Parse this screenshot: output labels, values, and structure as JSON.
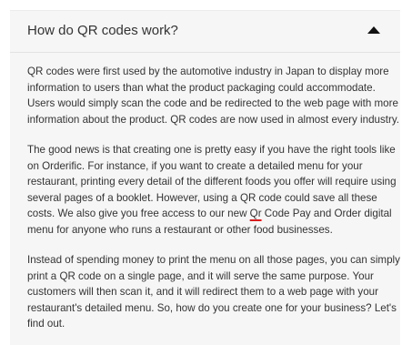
{
  "faq": {
    "question": "How do QR codes work?",
    "toggle_icon": "caret-up-icon",
    "paragraphs": [
      {
        "lines": [
          "QR codes were first used by the automotive industry in Japan to display more",
          "information to users than what the product packaging could accommodate.",
          "Users would simply scan the code and be redirected to the web page with more",
          "information about the product. QR codes are now used in almost every industry."
        ]
      },
      {
        "lines": [
          "The good news is that creating one is pretty easy if you have the right tools like",
          "on Orderific. For instance, if you want to create a detailed menu for your",
          "restaurant, printing every detail of the different foods you offer will require using",
          "several pages of a booklet. However, using a QR code could save all these"
        ],
        "line5": {
          "before": "costs. We also give you free access to our new ",
          "marked_word": "Qr",
          "after": " Code Pay and Order digital"
        },
        "line6": {
          "before": "menu for anyone who runs a restaurant or other ",
          "marked_word": "food",
          "after": " businesses."
        }
      },
      {
        "lines": [
          "Instead of spending money to print the menu on all those pages, you can simply",
          "print a QR code on a single page, and it will serve the same purpose. Your",
          "customers will then scan it, and it will redirect them to a web page with your",
          "restaurant's detailed menu. So, how do you create one for your business? Let's",
          "find out."
        ]
      }
    ]
  },
  "colors": {
    "panel_background": "#f6f6f6",
    "text": "#333333",
    "spellcheck_underline": "#d81c1c"
  }
}
